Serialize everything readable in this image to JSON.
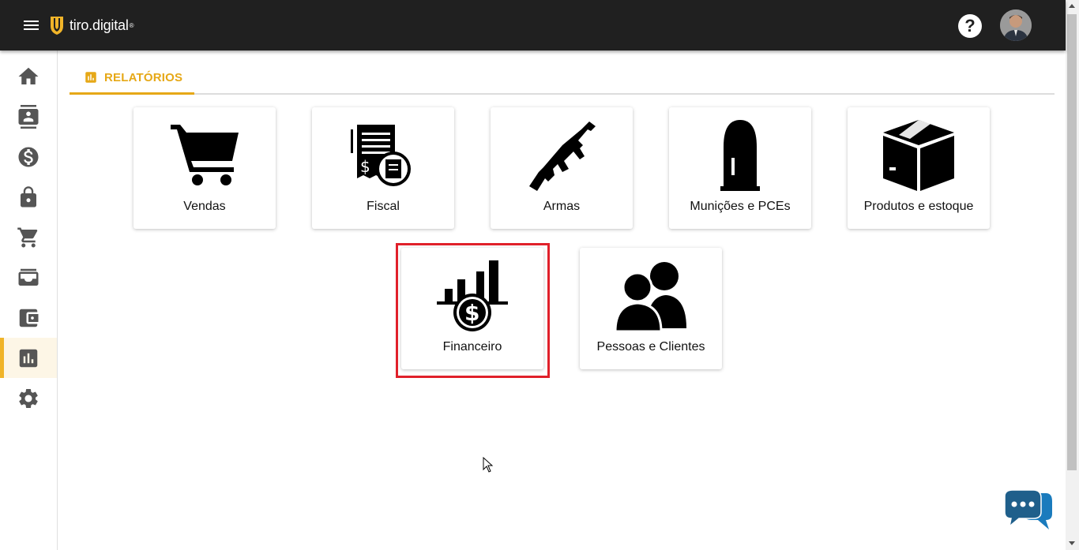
{
  "header": {
    "logo_text": "tiro.digital",
    "logo_reg": "®",
    "help_label": "?"
  },
  "sidebar": {
    "items": [
      {
        "name": "home",
        "icon": "home-icon",
        "active": false
      },
      {
        "name": "contacts",
        "icon": "contact-card-icon",
        "active": false
      },
      {
        "name": "finance",
        "icon": "dollar-icon",
        "active": false
      },
      {
        "name": "security",
        "icon": "lock-icon",
        "active": false
      },
      {
        "name": "cart",
        "icon": "cart-icon",
        "active": false
      },
      {
        "name": "inbox",
        "icon": "inbox-icon",
        "active": false
      },
      {
        "name": "wallet",
        "icon": "wallet-icon",
        "active": false
      },
      {
        "name": "reports",
        "icon": "bar-chart-icon",
        "active": true
      },
      {
        "name": "settings",
        "icon": "gear-icon",
        "active": false
      }
    ]
  },
  "tab": {
    "label": "RELATÓRIOS",
    "icon": "bar-chart-icon"
  },
  "cards": [
    {
      "label": "Vendas",
      "icon": "cart-icon"
    },
    {
      "label": "Fiscal",
      "icon": "receipt-icon"
    },
    {
      "label": "Armas",
      "icon": "rifle-icon"
    },
    {
      "label": "Munições e PCEs",
      "icon": "bullet-icon"
    },
    {
      "label": "Produtos e estoque",
      "icon": "box-icon"
    },
    {
      "label": "Financeiro",
      "icon": "finance-chart-icon"
    },
    {
      "label": "Pessoas e Clientes",
      "icon": "people-icon"
    }
  ],
  "colors": {
    "topbar": "#202020",
    "accent": "#e6a817",
    "highlight": "#e0202a",
    "chat": "#1f5f8b"
  }
}
